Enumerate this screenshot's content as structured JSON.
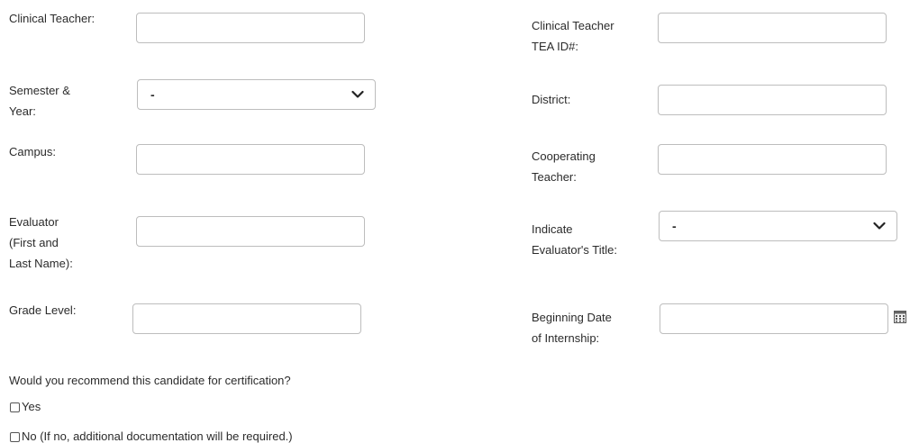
{
  "form": {
    "left": {
      "clinical_teacher": {
        "label_lines": [
          "Clinical Teacher:"
        ],
        "value": ""
      },
      "semester_year": {
        "label_lines": [
          "Semester &",
          "Year:"
        ],
        "selected": "-"
      },
      "campus": {
        "label_lines": [
          "Campus:"
        ],
        "value": ""
      },
      "evaluator": {
        "label_lines": [
          "Evaluator",
          "(First and",
          "Last Name):"
        ],
        "value": ""
      },
      "grade_level": {
        "label_lines": [
          "Grade Level:"
        ],
        "value": ""
      }
    },
    "right": {
      "clinical_teacher_tea_id": {
        "label_lines": [
          "Clinical Teacher",
          "TEA ID#:"
        ],
        "value": ""
      },
      "district": {
        "label_lines": [
          "District:"
        ],
        "value": ""
      },
      "cooperating_teacher": {
        "label_lines": [
          "Cooperating",
          "Teacher:"
        ],
        "value": ""
      },
      "evaluator_title": {
        "label_lines": [
          "Indicate",
          "Evaluator's Title:"
        ],
        "selected": "-"
      },
      "beginning_date": {
        "label_lines": [
          "Beginning Date",
          "of Internship:"
        ],
        "value": ""
      }
    },
    "recommendation": {
      "question": "Would you recommend this candidate for certification?",
      "options": [
        {
          "label": "Yes",
          "checked": false
        },
        {
          "label": "No (If no, additional documentation will be required.)",
          "checked": false
        }
      ]
    }
  },
  "icons": {
    "select_arrow": "chevron-down-icon",
    "date_picker": "calendar-icon"
  }
}
